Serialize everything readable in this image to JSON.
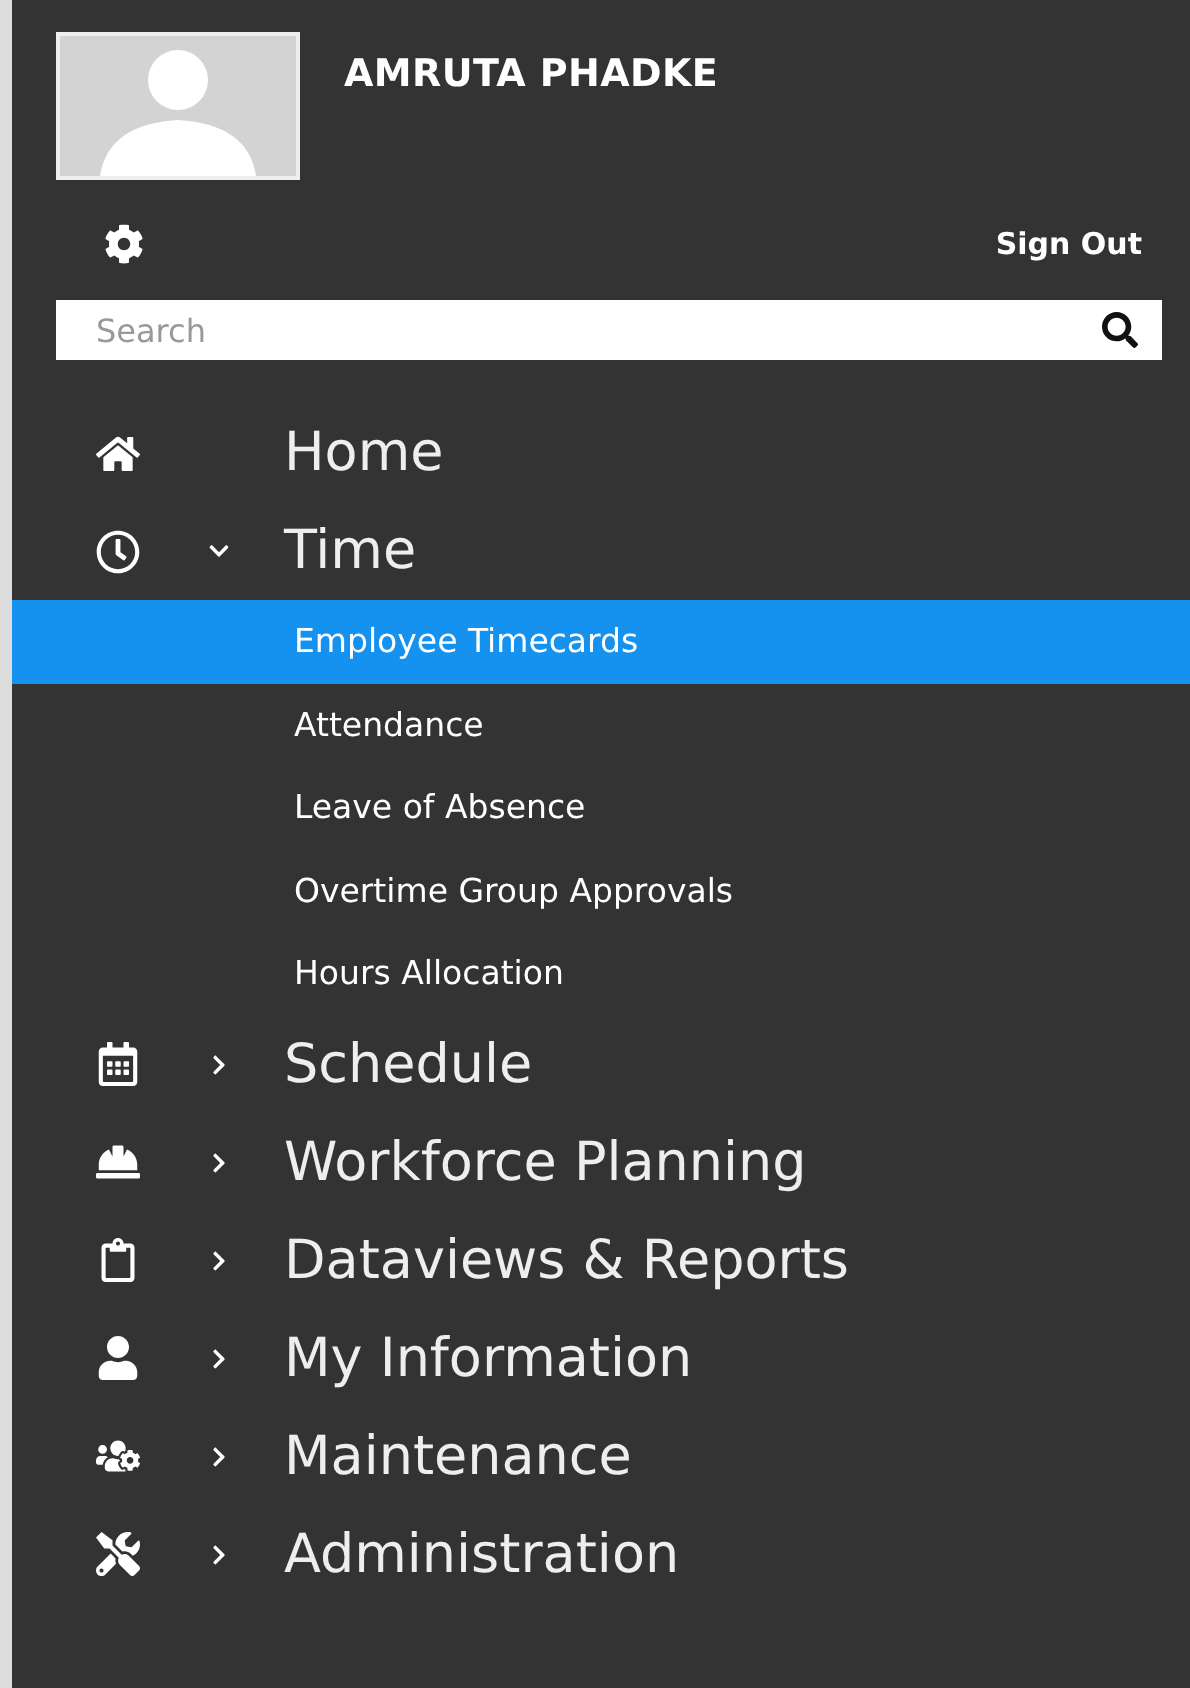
{
  "user": {
    "name": "AMRUTA **PHADKE**"
  },
  "sign_out": "Sign Out",
  "search": {
    "placeholder": "Search"
  },
  "menu": [
    {
      "label": "Home"
    },
    {
      "label": "Time",
      "expanded": true,
      "children": [
        {
          "label": "Employee Timecards",
          "selected": true
        },
        {
          "label": "Attendance",
          "selected": false
        },
        {
          "label": "Leave of Absence",
          "selected": false
        },
        {
          "label": "Overtime Group Approvals",
          "selected": false
        },
        {
          "label": "Hours Allocation",
          "selected": false
        }
      ]
    },
    {
      "label": "Schedule",
      "expanded": false
    },
    {
      "label": "Workforce Planning",
      "expanded": false
    },
    {
      "label": "Dataviews & Reports",
      "expanded": false
    },
    {
      "label": "My Information",
      "expanded": false
    },
    {
      "label": "Maintenance",
      "expanded": false
    },
    {
      "label": "Administration",
      "expanded": false
    }
  ]
}
